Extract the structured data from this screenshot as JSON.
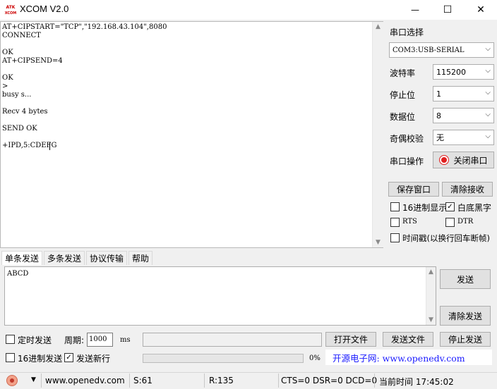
{
  "window": {
    "title": "XCOM V2.0",
    "logo_top": "ATK",
    "logo_bottom": "XCOM",
    "minimize": "—",
    "maximize": "☐",
    "close": "✕"
  },
  "receive": {
    "text": "AT+CIPSTART=\"TCP\",\"192.168.43.104\",8080\nCONNECT\n\nOK\nAT+CIPSEND=4\n\nOK\n>\nbusy s...\n\nRecv 4 bytes\n\nSEND OK\n\n+IPD,5:CDEFG"
  },
  "serial": {
    "port_label": "串口选择",
    "port_value": "COM3:USB-SERIAL",
    "baud_label": "波特率",
    "baud_value": "115200",
    "stop_label": "停止位",
    "stop_value": "1",
    "data_label": "数据位",
    "data_value": "8",
    "parity_label": "奇偶校验",
    "parity_value": "无",
    "op_label": "串口操作",
    "op_button": "关闭串口",
    "save_button": "保存窗口",
    "clear_recv_button": "清除接收",
    "hex_display": "16进制显示",
    "white_bg": "白底黑字",
    "white_bg_checked": true,
    "rts": "RTS",
    "dtr": "DTR",
    "timestamp": "时间戳(以换行回车断帧)"
  },
  "tabs": [
    "单条发送",
    "多条发送",
    "协议传输",
    "帮助"
  ],
  "send": {
    "text": "ABCD",
    "send_button": "发送",
    "clear_send_button": "清除发送",
    "timed_send": "定时发送",
    "period_label": "周期:",
    "period_value": "1000",
    "period_unit": "ms",
    "open_file": "打开文件",
    "send_file": "发送文件",
    "stop_send": "停止发送",
    "hex_send": "16进制发送",
    "newline": "发送新行",
    "newline_checked": true,
    "progress": "0%",
    "promo": "开源电子网: www.openedv.com"
  },
  "status": {
    "website": "www.openedv.com",
    "sent": "S:61",
    "received": "R:135",
    "lines": "CTS=0 DSR=0 DCD=0",
    "time": "当前时间 17:45:02"
  },
  "colors": {
    "promo": "#1a1aff",
    "record_red": "#e02020"
  }
}
